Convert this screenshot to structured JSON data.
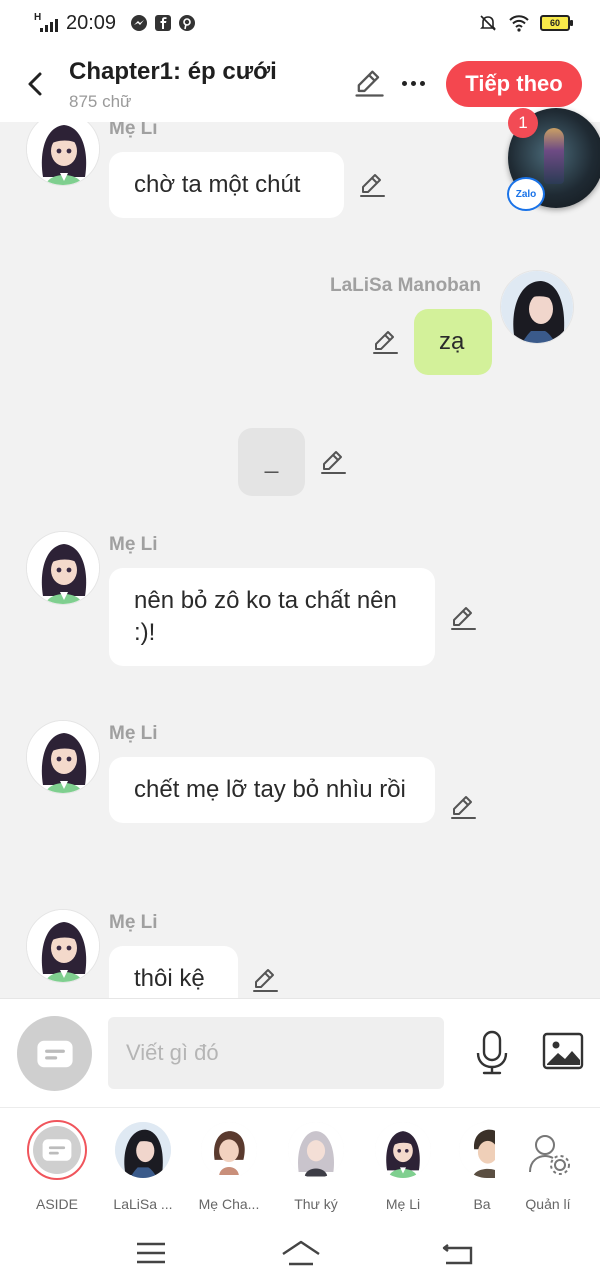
{
  "status_bar": {
    "network": "H",
    "time": "20:09",
    "battery": "60"
  },
  "header": {
    "title": "Chapter1: ép cưới",
    "subtitle": "875 chữ",
    "next_label": "Tiếp theo"
  },
  "floating_bubble": {
    "badge_count": "1",
    "app_label": "Zalo"
  },
  "messages": [
    {
      "speaker": "Mẹ Li",
      "text": "chờ ta một chút"
    },
    {
      "speaker": "LaLiSa Manoban",
      "text": "zạ"
    },
    {
      "speaker": "",
      "text": "_"
    },
    {
      "speaker": "Mẹ Li",
      "text": "nên bỏ zô ko ta chất nên :)!"
    },
    {
      "speaker": "Mẹ Li",
      "text": "chết mẹ lỡ tay bỏ nhìu rồi"
    },
    {
      "speaker": "Mẹ Li",
      "text": "thôi kệ"
    }
  ],
  "composer": {
    "placeholder": "Viết gì đó",
    "value": ""
  },
  "characters": [
    {
      "label": "ASIDE"
    },
    {
      "label": "LaLiSa ..."
    },
    {
      "label": "Mẹ Cha..."
    },
    {
      "label": "Thư ký"
    },
    {
      "label": "Mẹ Li"
    },
    {
      "label": "Ba"
    },
    {
      "label": "Quản lí"
    }
  ],
  "colors": {
    "accent": "#f4474f",
    "my_bubble": "#d3f19a",
    "background": "#f2f2f2"
  }
}
